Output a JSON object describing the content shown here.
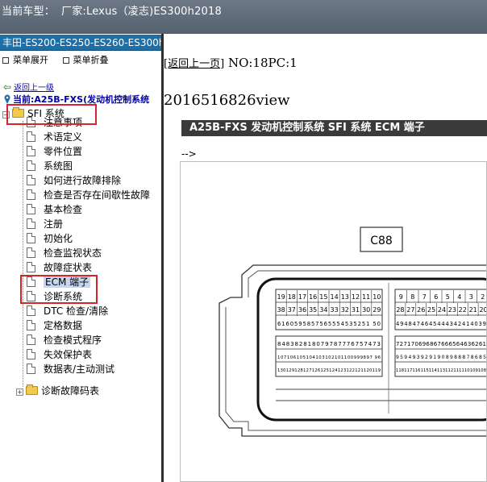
{
  "topbar": {
    "label": "当前车型：",
    "value": "厂家:Lexus（凌志)ES300h2018"
  },
  "sidebar": {
    "model_header": "丰田-ES200-ES250-ES260-ES300h",
    "menu": {
      "expand": "菜单展开",
      "collapse": "菜单折叠"
    },
    "back": "返回上一级",
    "current": "当前:A25B-FXS(发动机控制系统",
    "section": "SFI 系统",
    "items": [
      "注意事项",
      "术语定义",
      "零件位置",
      "系统图",
      "如何进行故障排除",
      "检查是否存在间歇性故障",
      "基本检查",
      "注册",
      "初始化",
      "检查监视状态",
      "故障症状表",
      "ECM 端子",
      "诊断系统",
      "DTC 检查/清除",
      "定格数据",
      "检查模式程序",
      "失效保护表",
      "数据表/主动测试"
    ],
    "dtc_folder": "诊断故障码表"
  },
  "content": {
    "back_link": "[返回上一页]",
    "page_info": "NO:18PC:1",
    "view_id": "2016516826view",
    "banner": "A25B-FXS 发动机控制系统  SFI 系统  ECM 端子",
    "comment": "-->",
    "connector": {
      "label": "C88",
      "left_row1": [
        "19",
        "18",
        "17",
        "16",
        "15",
        "14",
        "13",
        "12",
        "11",
        "10"
      ],
      "left_row2": [
        "38",
        "37",
        "36",
        "35",
        "34",
        "33",
        "32",
        "31",
        "30",
        "29"
      ],
      "left_row3": "6160595857565554535251 50",
      "right_row1": [
        "9",
        "8",
        "7",
        "6",
        "5",
        "4",
        "3",
        "2"
      ],
      "right_row2": [
        "28",
        "27",
        "26",
        "25",
        "24",
        "23",
        "22",
        "21",
        "20"
      ],
      "right_row3": "4948474645444342414039",
      "left_row4": "848382818079787776757473",
      "left_row5": "107106105104103102101100999897 96",
      "left_row6": "130129128127126125124123122121120119",
      "right_row4": "727170696867666564636261",
      "right_row5": "9594939291908988878685",
      "right_row6": "118117116115114113112111110109108"
    }
  },
  "colors": {
    "header_blue": "#1e6fa8",
    "highlight_red": "#d9232a",
    "banner_dark": "#3a3a3a"
  }
}
